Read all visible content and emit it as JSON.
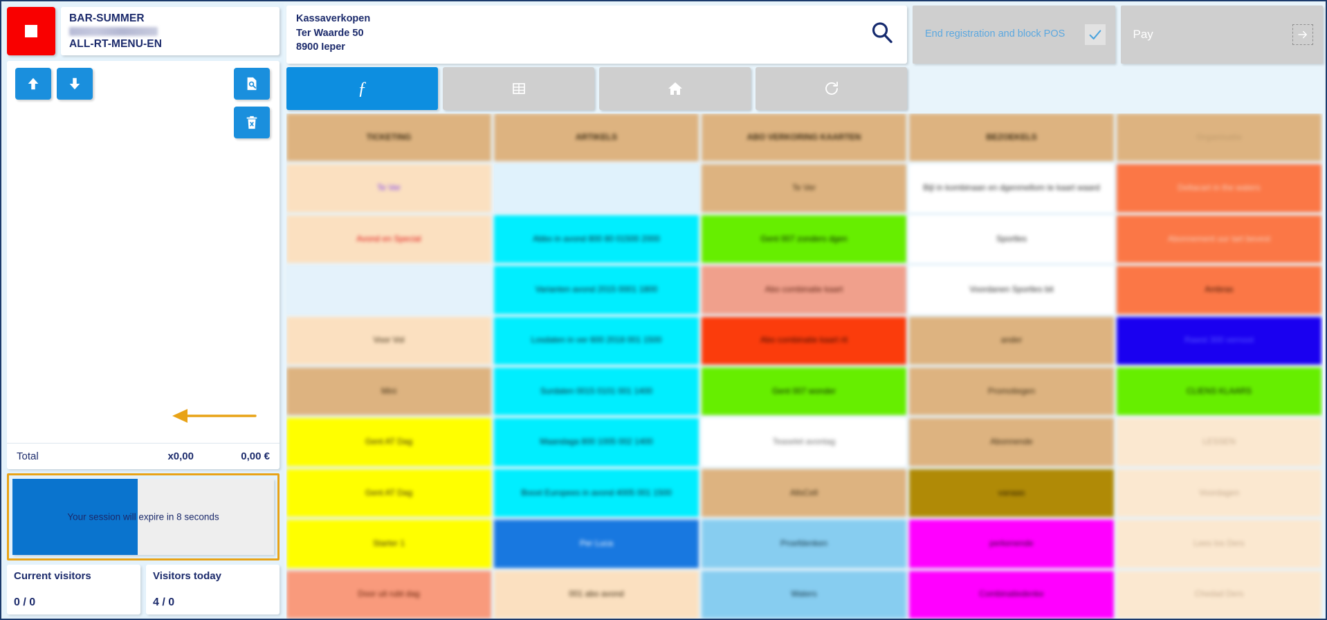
{
  "accent": "#0d8ee0",
  "left": {
    "stop_button": "stop-square",
    "session_title_line1": "BAR-SUMMER",
    "session_title_redacted": "",
    "session_title_line3": "ALL-RT-MENU-EN",
    "tools": {
      "scroll_up": "arrow-up",
      "scroll_down": "arrow-down",
      "view_document": "document-search",
      "delete_all": "trash-x"
    },
    "total": {
      "label": "Total",
      "quantity": "x0,00",
      "amount": "0,00 €"
    },
    "session": {
      "message": "Your session will expire in 8 seconds",
      "progress_percent": 48,
      "fill_color": "#0a74ce",
      "highlight_color": "#e8a317"
    },
    "visitors": [
      {
        "label": "Current visitors",
        "value": "0 / 0"
      },
      {
        "label": "Visitors today",
        "value": "4 / 0"
      }
    ]
  },
  "header": {
    "address": [
      "Kassaverkopen",
      "Ter Waarde 50",
      "8900 Ieper"
    ],
    "search_icon": "search-icon",
    "block_pos": {
      "label": "End registration and block POS",
      "icon": "check-icon"
    },
    "pay": {
      "label": "Pay",
      "icon": "arrow-right-icon"
    }
  },
  "toolbar": [
    {
      "name": "function-keys",
      "icon": "function-f",
      "active": true
    },
    {
      "name": "grid-view",
      "icon": "grid-icon",
      "active": false
    },
    {
      "name": "home",
      "icon": "home-icon",
      "active": false
    },
    {
      "name": "refresh",
      "icon": "refresh-icon",
      "active": false
    }
  ],
  "grid": {
    "columns": [
      {
        "header": {
          "text": "TICKETING",
          "bg": "#ddb380",
          "fg": "#3a2a10"
        },
        "cells": [
          {
            "text": "Te Ver",
            "bg": "#fbe0c0",
            "fg": "#7b3df0"
          },
          {
            "text": "Avond en Special",
            "bg": "#fbe0c0",
            "fg": "#e01010"
          },
          {
            "text": "",
            "bg": "#e4f2fb",
            "fg": "#000000"
          },
          {
            "text": "Voor Vol",
            "bg": "#fbe0c0",
            "fg": "#3a2a10"
          },
          {
            "text": "Mini",
            "bg": "#ddb380",
            "fg": "#3a2a10"
          },
          {
            "text": "Gent AT Dag",
            "bg": "#ffff00",
            "fg": "#3a2a10"
          },
          {
            "text": "Gent AT Dag",
            "bg": "#ffff00",
            "fg": "#3a2a10"
          },
          {
            "text": "Starter 1",
            "bg": "#ffff00",
            "fg": "#3a2a10"
          },
          {
            "text": "Door uit rubt dag",
            "bg": "#f99a7c",
            "fg": "#5a1a00"
          }
        ]
      },
      {
        "header": {
          "text": "ARTIKELS",
          "bg": "#ddb380",
          "fg": "#3a2a10"
        },
        "cells": [
          {
            "text": "",
            "bg": "#e0f2fc",
            "fg": "#000000"
          },
          {
            "text": "Abbo in avond 800 80 01500 2000",
            "bg": "#00eeff",
            "fg": "#102030"
          },
          {
            "text": "Varianten avond 2015 0001 1800",
            "bg": "#00eeff",
            "fg": "#102030"
          },
          {
            "text": "Losdaten in ver 600 2018 001 1500",
            "bg": "#00eeff",
            "fg": "#102030"
          },
          {
            "text": "Surdaten 0015 0101 001 1400",
            "bg": "#00eeff",
            "fg": "#102030"
          },
          {
            "text": "Maandaga 800 1005 002 1400",
            "bg": "#00eeff",
            "fg": "#102030"
          },
          {
            "text": "Booxt Europees in avond 4005 001 1500",
            "bg": "#00eeff",
            "fg": "#102030"
          },
          {
            "text": "Per Luca",
            "bg": "#1878e0",
            "fg": "#ffffff"
          },
          {
            "text": "001 abo avond",
            "bg": "#fbe0c0",
            "fg": "#3a2a10"
          }
        ]
      },
      {
        "header": {
          "text": "ABO VERKORING KAARTEN",
          "bg": "#ddb380",
          "fg": "#3a2a10"
        },
        "cells": [
          {
            "text": "Te Ver",
            "bg": "#ddb380",
            "fg": "#3a2a10"
          },
          {
            "text": "Gent 007 zonders dgen",
            "bg": "#66ee00",
            "fg": "#0a2000"
          },
          {
            "text": "Abo combinatie kaart",
            "bg": "#f0a08c",
            "fg": "#5a2010"
          },
          {
            "text": "Abo combinatie kaart rit",
            "bg": "#fb3c0c",
            "fg": "#3a0800"
          },
          {
            "text": "Gent 007 wonder",
            "bg": "#66ee00",
            "fg": "#0a2000"
          },
          {
            "text": "Teaselet avontag",
            "bg": "#ffffff",
            "fg": "#707070"
          },
          {
            "text": "AllsCell",
            "bg": "#ddb380",
            "fg": "#3a2a10"
          },
          {
            "text": "Proefdenken",
            "bg": "#87cdf0",
            "fg": "#103040"
          },
          {
            "text": "Waters",
            "bg": "#87cdf0",
            "fg": "#103040"
          }
        ]
      },
      {
        "header": {
          "text": "BEZOEKELS",
          "bg": "#ddb380",
          "fg": "#3a2a10"
        },
        "cells": [
          {
            "text": "Bijl in kombinaan en dgenmellom te kaart waard",
            "bg": "#ffffff",
            "fg": "#303030"
          },
          {
            "text": "Sportles",
            "bg": "#ffffff",
            "fg": "#303030"
          },
          {
            "text": "Voordanen Sportles bit",
            "bg": "#ffffff",
            "fg": "#303030"
          },
          {
            "text": "ander",
            "bg": "#ddb380",
            "fg": "#3a2a10"
          },
          {
            "text": "Promotiegen",
            "bg": "#ddb380",
            "fg": "#3a2a10"
          },
          {
            "text": "Abonnende",
            "bg": "#ddb380",
            "fg": "#3a2a10"
          },
          {
            "text": "vanaas",
            "bg": "#b08a06",
            "fg": "#2a1a00"
          },
          {
            "text": "perkenende",
            "bg": "#ff00ff",
            "fg": "#300030"
          },
          {
            "text": "Combinatiedenke",
            "bg": "#ff00ff",
            "fg": "#300030"
          }
        ]
      },
      {
        "header": {
          "text": "Organisatie",
          "bg": "#ddb380",
          "fg": "#c6a070"
        },
        "cells": [
          {
            "text": "Deltacart in the waters",
            "bg": "#fb7746",
            "fg": "#f8d0bc"
          },
          {
            "text": "Abonnement uur tart bevest",
            "bg": "#fb7746",
            "fg": "#f8d0bc"
          },
          {
            "text": "Ambras",
            "bg": "#fb7746",
            "fg": "#3a1000"
          },
          {
            "text": "Rawst 300 vernoot",
            "bg": "#1a00f0",
            "fg": "#5a5aff"
          },
          {
            "text": "CLIENS KLAARS",
            "bg": "#66ee00",
            "fg": "#0a2000"
          },
          {
            "text": "LESSEN",
            "bg": "#fbe8d0",
            "fg": "#c2a88c"
          },
          {
            "text": "Voordagen",
            "bg": "#fbe8d0",
            "fg": "#c2a88c"
          },
          {
            "text": "Lees los Ders",
            "bg": "#fbe8d0",
            "fg": "#c2a88c"
          },
          {
            "text": "Chedad Ders",
            "bg": "#fbe8d0",
            "fg": "#c2a88c"
          }
        ]
      }
    ]
  }
}
